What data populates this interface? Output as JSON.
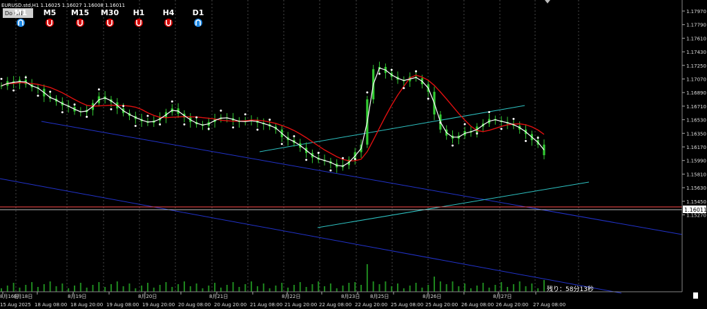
{
  "symbol_info": "EURUSD.std,H1  1.16025 1.16027 1.16008 1.16011",
  "overlay_button": "Do  ON",
  "timeframes": [
    {
      "label": "M1",
      "color": "#1e88e5",
      "dir": "up"
    },
    {
      "label": "M5",
      "color": "#d50000",
      "dir": "down"
    },
    {
      "label": "M15",
      "color": "#d50000",
      "dir": "down"
    },
    {
      "label": "M30",
      "color": "#d50000",
      "dir": "down"
    },
    {
      "label": "H1",
      "color": "#d50000",
      "dir": "down"
    },
    {
      "label": "H4",
      "color": "#d50000",
      "dir": "down"
    },
    {
      "label": "D1",
      "color": "#1e88e5",
      "dir": "up"
    }
  ],
  "current_price": "1.16011",
  "remaining_time": "残り：58分13秒",
  "y_labels": [
    "1.17970",
    "1.17790",
    "1.17610",
    "1.17430",
    "1.17250",
    "1.17070",
    "1.16890",
    "1.16710",
    "1.16530",
    "1.16350",
    "1.16170",
    "1.15990",
    "1.15810",
    "1.15630",
    "1.15450",
    "1.15270"
  ],
  "time_labels": [
    "15 Aug 2025",
    "18 Aug 08:00",
    "18 Aug 20:00",
    "19 Aug 08:00",
    "19 Aug 20:00",
    "20 Aug 08:00",
    "20 Aug 20:00",
    "21 Aug 08:00",
    "21 Aug 20:00",
    "22 Aug 08:00",
    "22 Aug 20:00",
    "25 Aug 08:00",
    "25 Aug 20:00",
    "26 Aug 08:00",
    "26 Aug 20:00",
    "27 Aug 08:00"
  ],
  "day_markers": [
    "8月16日",
    "8月18日",
    "8月19日",
    "8月20日",
    "8月21日",
    "8月22日",
    "8月23日",
    "8月25日",
    "8月26日",
    "8月27日"
  ],
  "chart_data": {
    "type": "line",
    "series": [
      {
        "values": [
          1.1698,
          1.1704,
          1.1701,
          1.1706,
          1.17,
          1.1696,
          1.1694,
          1.1684,
          1.1681,
          1.1677,
          1.1672,
          1.167,
          1.1664,
          1.1663,
          1.1666,
          1.1675,
          1.1684,
          1.168,
          1.1676,
          1.1668,
          1.1662,
          1.1658,
          1.1654,
          1.1651,
          1.1649,
          1.1652,
          1.1656,
          1.1663,
          1.1668,
          1.1661,
          1.1656,
          1.165,
          1.1647,
          1.1645,
          1.165,
          1.1654,
          1.1656,
          1.1655,
          1.1652,
          1.165,
          1.1651,
          1.1652,
          1.1649,
          1.1647,
          1.1644,
          1.164,
          1.163,
          1.1626,
          1.1622,
          1.1616,
          1.1609,
          1.1603,
          1.16,
          1.1598,
          1.1595,
          1.159,
          1.1593,
          1.16,
          1.161,
          1.162,
          1.168,
          1.172,
          1.1723,
          1.1715,
          1.171,
          1.1706,
          1.1704,
          1.171,
          1.1708,
          1.17,
          1.169,
          1.166,
          1.164,
          1.1632,
          1.1628,
          1.1632,
          1.1638,
          1.1636,
          1.1644,
          1.1648,
          1.1654,
          1.1652,
          1.165,
          1.1648,
          1.1645,
          1.164,
          1.1634,
          1.1626,
          1.162,
          1.1606
        ]
      }
    ],
    "candles_approx": true
  }
}
